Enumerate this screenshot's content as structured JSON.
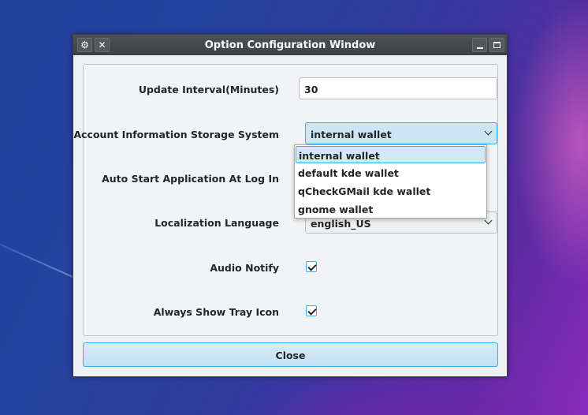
{
  "window": {
    "title": "Option Configuration Window",
    "titlebar_left_icons": [
      "gear-icon",
      "close-icon"
    ],
    "titlebar_right_icons": [
      "minimize-icon",
      "maximize-icon"
    ]
  },
  "form": {
    "update_interval": {
      "label": "Update Interval(Minutes)",
      "value": "30"
    },
    "storage_system": {
      "label": "Account Information Storage System",
      "value": "internal wallet",
      "options": [
        "internal wallet",
        "default kde wallet",
        "qCheckGMail kde wallet",
        "gnome wallet"
      ]
    },
    "auto_start": {
      "label": "Auto Start Application At Log In"
    },
    "localization": {
      "label": "Localization Language",
      "value": "english_US"
    },
    "audio_notify": {
      "label": "Audio Notify",
      "checked": true
    },
    "tray_icon": {
      "label": "Always Show Tray Icon",
      "checked": true
    }
  },
  "buttons": {
    "close": "Close"
  },
  "colors": {
    "accent": "#3daee9",
    "titlebar": "#475057",
    "window_bg": "#eff0f1"
  }
}
